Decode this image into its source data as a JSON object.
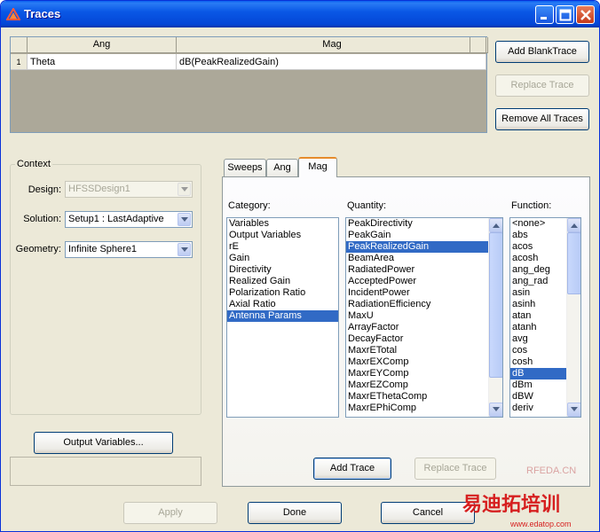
{
  "window": {
    "title": "Traces",
    "minimize_icon": "minimize-icon",
    "maximize_icon": "maximize-icon",
    "close_icon": "close-icon"
  },
  "grid": {
    "columns": [
      "Ang",
      "Mag"
    ],
    "rows": [
      {
        "index": "1",
        "ang": "Theta",
        "mag": "dB(PeakRealizedGain)"
      }
    ]
  },
  "side_buttons": {
    "add_blank": "Add BlankTrace",
    "replace": "Replace Trace",
    "remove_all": "Remove All Traces"
  },
  "context": {
    "legend": "Context",
    "design_label": "Design:",
    "design_value": "HFSSDesign1",
    "solution_label": "Solution:",
    "solution_value": "Setup1 : LastAdaptive",
    "geometry_label": "Geometry:",
    "geometry_value": "Infinite Sphere1"
  },
  "output_variables_button": "Output Variables...",
  "tabs": [
    "Sweeps",
    "Ang",
    "Mag"
  ],
  "active_tab": "Mag",
  "mag_panel": {
    "category_label": "Category:",
    "quantity_label": "Quantity:",
    "function_label": "Function:",
    "categories": [
      "Variables",
      "Output Variables",
      "rE",
      "Gain",
      "Directivity",
      "Realized Gain",
      "Polarization Ratio",
      "Axial Ratio",
      "Antenna Params"
    ],
    "selected_category": "Antenna Params",
    "quantities": [
      "PeakDirectivity",
      "PeakGain",
      "PeakRealizedGain",
      "BeamArea",
      "RadiatedPower",
      "AcceptedPower",
      "IncidentPower",
      "RadiationEfficiency",
      "MaxU",
      "ArrayFactor",
      "DecayFactor",
      "MaxrETotal",
      "MaxrEXComp",
      "MaxrEYComp",
      "MaxrEZComp",
      "MaxrEThetaComp",
      "MaxrEPhiComp"
    ],
    "selected_quantity": "PeakRealizedGain",
    "functions": [
      "<none>",
      "abs",
      "acos",
      "acosh",
      "ang_deg",
      "ang_rad",
      "asin",
      "asinh",
      "atan",
      "atanh",
      "avg",
      "cos",
      "cosh",
      "dB",
      "dBm",
      "dBW",
      "deriv"
    ],
    "selected_function": "dB",
    "add_trace": "Add Trace",
    "replace_trace": "Replace Trace"
  },
  "bottom_buttons": {
    "apply": "Apply",
    "done": "Done",
    "cancel": "Cancel"
  },
  "watermarks": {
    "rfeda": "RFEDA.CN",
    "logo_text": "易迪拓培训",
    "url": "www.edatop.com"
  },
  "colors": {
    "title_bar": "#0a58e6",
    "selection": "#316ac5",
    "dialog_bg": "#ece9d8",
    "tab_accent": "#e68b2c"
  }
}
